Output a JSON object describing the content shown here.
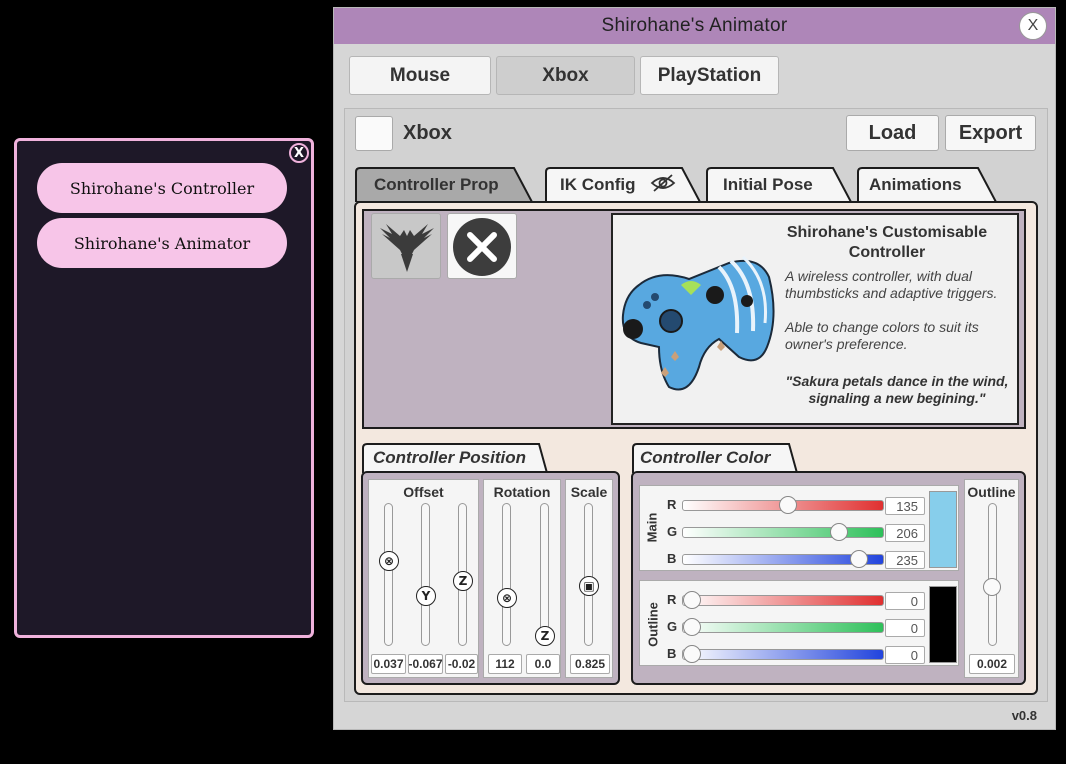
{
  "launcher": {
    "close_label": "X",
    "buttons": [
      "Shirohane's Controller",
      "Shirohane's Animator"
    ]
  },
  "window": {
    "title": "Shirohane's Animator",
    "close_label": "X",
    "version": "v0.8"
  },
  "top_tabs": [
    {
      "label": "Mouse",
      "active": false
    },
    {
      "label": "Xbox",
      "active": true
    },
    {
      "label": "PlayStation",
      "active": false
    }
  ],
  "toolbar": {
    "checkbox_checked": false,
    "name": "Xbox",
    "load_label": "Load",
    "export_label": "Export"
  },
  "tabs": [
    "Controller Prop",
    "IK Config",
    "Initial Pose",
    "Animations"
  ],
  "prop": {
    "title": "Shirohane's Customisable Controller",
    "description1": "A wireless controller, with dual thumbsticks and adaptive triggers.",
    "description2": "Able to change colors to suit its owner's preference.",
    "quote": "\"Sakura petals dance in the wind, signaling a new begining.\""
  },
  "position": {
    "tab_label": "Controller Position",
    "offset_title": "Offset",
    "rotation_title": "Rotation",
    "scale_title": "Scale",
    "offset_values": [
      "0.037",
      "-0.067",
      "-0.02"
    ],
    "rotation_values": [
      "112",
      "0.0"
    ],
    "scale_value": "0.825"
  },
  "color": {
    "tab_label": "Controller Color",
    "main_label": "Main",
    "outline_label": "Outline",
    "outline_title": "Outline",
    "channels": [
      "R",
      "G",
      "B"
    ],
    "main_values": [
      "135",
      "206",
      "235"
    ],
    "outline_values": [
      "0",
      "0",
      "0"
    ],
    "main_swatch": "#87ceeb",
    "outline_swatch": "#000000",
    "outline_width": "0.002"
  }
}
